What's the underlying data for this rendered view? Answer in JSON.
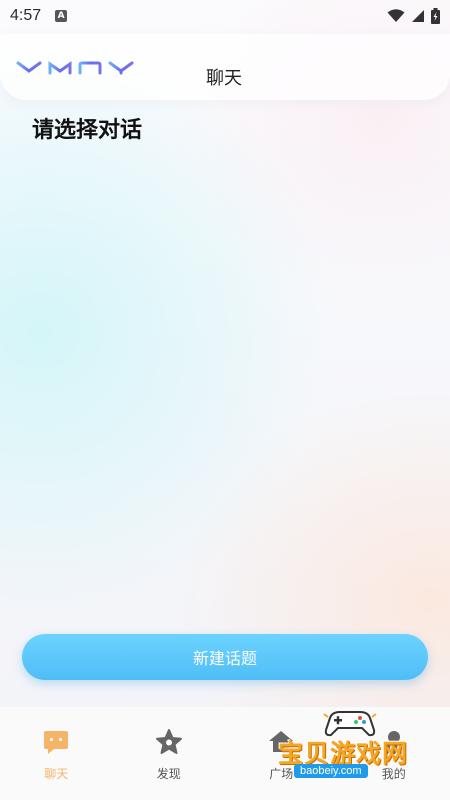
{
  "status_bar": {
    "time": "4:57",
    "notification_icon": "a-icon",
    "right_icons": [
      "wifi-icon",
      "signal-icon",
      "battery-icon"
    ]
  },
  "header": {
    "logo_text": "YMOY",
    "title": "聊天"
  },
  "main": {
    "heading": "请选择对话",
    "new_topic_button": "新建话题"
  },
  "tabbar": {
    "items": [
      {
        "label": "聊天",
        "icon": "chat-icon",
        "active": true
      },
      {
        "label": "发现",
        "icon": "discover-star-icon",
        "active": false
      },
      {
        "label": "广场",
        "icon": "square-home-icon",
        "active": false
      },
      {
        "label": "我的",
        "icon": "profile-icon",
        "active": false
      }
    ]
  },
  "watermark": {
    "text": "宝贝游戏网",
    "url": "baobeiy.com"
  },
  "colors": {
    "accent_active": "#f5b36a",
    "button_gradient_top": "#6cd3ff",
    "button_gradient_bottom": "#4fbdf6",
    "logo": "#6a6cf0"
  }
}
